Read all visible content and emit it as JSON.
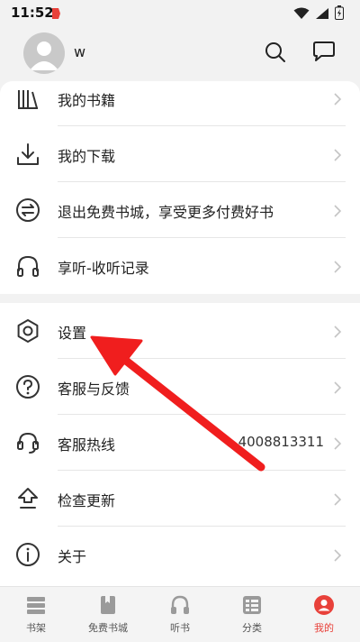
{
  "status_bar": {
    "time": "11:52"
  },
  "header": {
    "username": "w"
  },
  "menu_top": [
    {
      "label": "我的书籍"
    },
    {
      "label": "我的下载"
    },
    {
      "label": "退出免费书城，享受更多付费好书"
    },
    {
      "label": "享听-收听记录"
    }
  ],
  "menu_bottom": [
    {
      "label": "设置"
    },
    {
      "label": "客服与反馈"
    },
    {
      "label": "客服热线",
      "value": "4008813311"
    },
    {
      "label": "检查更新"
    },
    {
      "label": "关于"
    }
  ],
  "tabs": [
    {
      "label": "书架"
    },
    {
      "label": "免费书城"
    },
    {
      "label": "听书"
    },
    {
      "label": "分类"
    },
    {
      "label": "我的"
    }
  ],
  "colors": {
    "accent": "#e8413a",
    "annotation_arrow": "#f01e1e"
  }
}
